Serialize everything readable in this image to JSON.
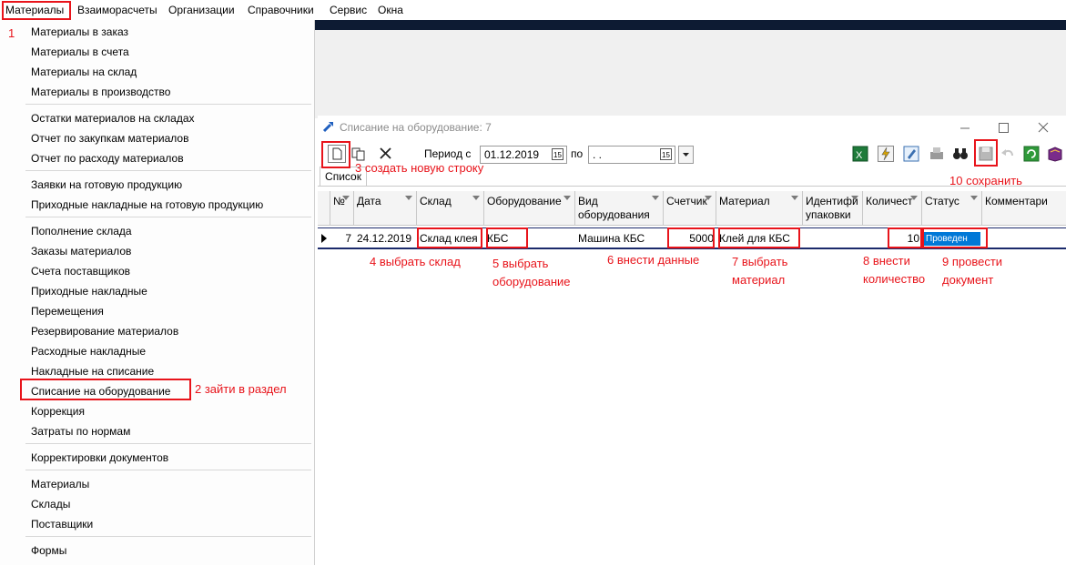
{
  "menubar": {
    "items": [
      "Материалы",
      "Взаиморасчеты",
      "Организации",
      "Справочники",
      "Сервис",
      "Окна"
    ]
  },
  "dropdown": {
    "items": [
      "Материалы в заказ",
      "Материалы в счета",
      "Материалы на склад",
      "Материалы в производство",
      "Остатки материалов на складах",
      "Отчет по закупкам материалов",
      "Отчет по расходу материалов",
      "Заявки на готовую продукцию",
      "Приходные накладные на готовую продукцию",
      "Пополнение склада",
      "Заказы материалов",
      "Счета поставщиков",
      "Приходные накладные",
      "Перемещения",
      "Резервирование материалов",
      "Расходные накладные",
      "Накладные на списание",
      "Списание на оборудование",
      "Коррекция",
      "Затраты по нормам",
      "Корректировки документов",
      "Материалы",
      "Склады",
      "Поставщики",
      "Формы"
    ]
  },
  "window": {
    "title": "Списание на оборудование: 7",
    "period_from_label": "Период с",
    "period_from": "01.12.2019",
    "period_to_label": "по",
    "period_to": " .  .",
    "tab": "Список"
  },
  "grid": {
    "columns": [
      "№",
      "Дата",
      "Склад",
      "Оборудование",
      "Вид оборудования",
      "Счетчик",
      "Материал",
      "Идентифи упаковки",
      "Количест",
      "Статус",
      "Комментари"
    ],
    "row": {
      "num": "7",
      "date": "24.12.2019",
      "sklad": "Склад клея",
      "oborud": "КБС",
      "vid": "Машина КБС",
      "schetchik": "5000",
      "material": "Клей для КБС",
      "ident": "",
      "kolvo": "10",
      "status": "Проведен",
      "comment": ""
    }
  },
  "annotations": {
    "a1": "1",
    "a2": "2 зайти в раздел",
    "a3": "3 создать новую строку",
    "a4": "4 выбрать склад",
    "a5": "5 выбрать оборудование",
    "a6": "6 внести данные",
    "a7": "7 выбрать материал",
    "a8": "8 внести количество",
    "a9": "9 провести документ",
    "a10": "10 сохранить"
  },
  "colors": {
    "annotation": "#e8141b",
    "status_bg": "#0078d7",
    "dark_bar": "#0d1b33"
  }
}
